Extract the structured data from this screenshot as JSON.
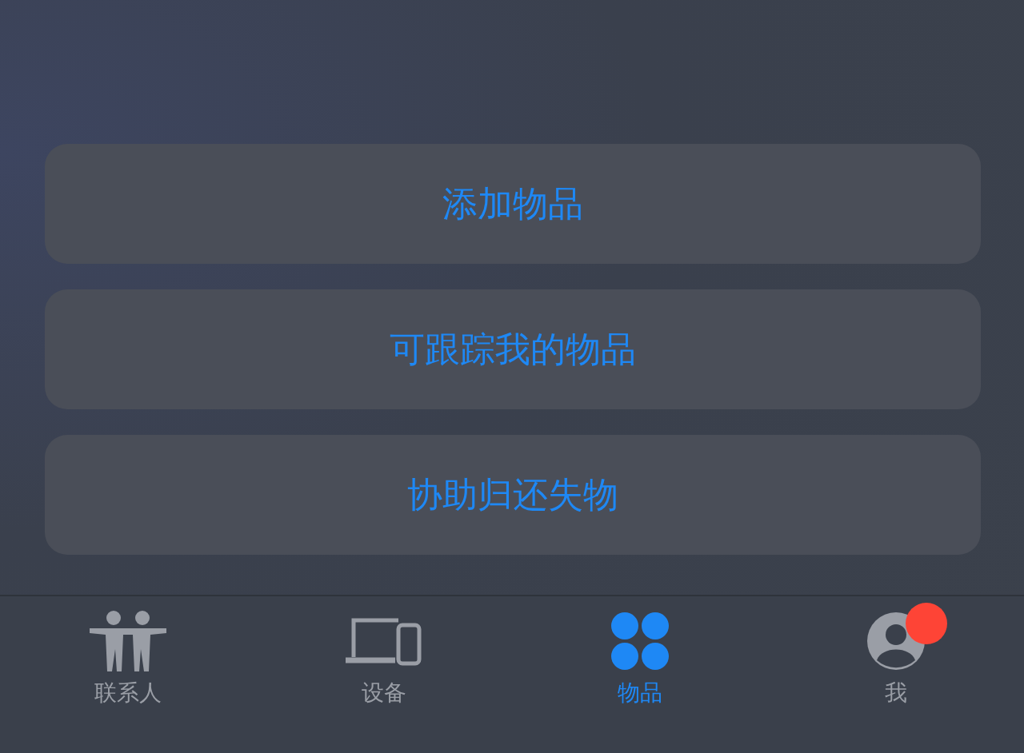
{
  "actions": [
    {
      "label": "添加物品"
    },
    {
      "label": "可跟踪我的物品"
    },
    {
      "label": "协助归还失物"
    }
  ],
  "tabs": [
    {
      "kind": "people",
      "label": "联系人",
      "selected": false,
      "badge": false
    },
    {
      "kind": "devices",
      "label": "设备",
      "selected": false,
      "badge": false
    },
    {
      "kind": "items",
      "label": "物品",
      "selected": true,
      "badge": false
    },
    {
      "kind": "me",
      "label": "我",
      "selected": false,
      "badge": true
    }
  ]
}
